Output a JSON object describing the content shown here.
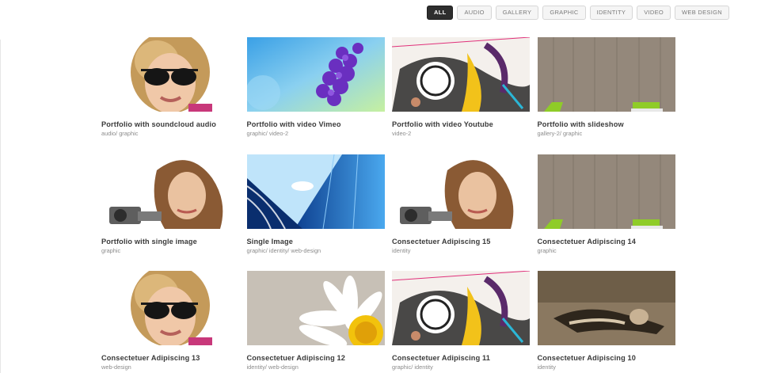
{
  "filters": [
    {
      "label": "ALL",
      "active": true
    },
    {
      "label": "AUDIO",
      "active": false
    },
    {
      "label": "GALLERY",
      "active": false
    },
    {
      "label": "GRAPHIC",
      "active": false
    },
    {
      "label": "IDENTITY",
      "active": false
    },
    {
      "label": "VIDEO",
      "active": false
    },
    {
      "label": "WEB DESIGN",
      "active": false
    }
  ],
  "items": [
    {
      "title": "Portfolio with soundcloud audio",
      "categories": "audio/ graphic",
      "image": "woman-sunglasses-photo"
    },
    {
      "title": "Portfolio with video Vimeo",
      "categories": "graphic/ video-2",
      "image": "purple-flowers-photo"
    },
    {
      "title": "Portfolio with video Youtube",
      "categories": "video-2",
      "image": "abstract-collage-art"
    },
    {
      "title": "Portfolio with slideshow",
      "categories": "gallery-2/ graphic",
      "image": "wood-wall-chairs-photo"
    },
    {
      "title": "Portfolio with single image",
      "categories": "graphic",
      "image": "woman-camera-photo"
    },
    {
      "title": "Single Image",
      "categories": "graphic/ identity/ web-design",
      "image": "glass-building-photo"
    },
    {
      "title": "Consectetuer Adipiscing 15",
      "categories": "identity",
      "image": "woman-camera-photo"
    },
    {
      "title": "Consectetuer Adipiscing 14",
      "categories": "graphic",
      "image": "wood-wall-chairs-photo"
    },
    {
      "title": "Consectetuer Adipiscing 13",
      "categories": "web-design",
      "image": "woman-sunglasses-photo"
    },
    {
      "title": "Consectetuer Adipiscing 12",
      "categories": "identity/ web-design",
      "image": "daisy-photo"
    },
    {
      "title": "Consectetuer Adipiscing 11",
      "categories": "graphic/ identity",
      "image": "abstract-collage-art"
    },
    {
      "title": "Consectetuer Adipiscing 10",
      "categories": "identity",
      "image": "sepia-woman-lying-photo"
    }
  ]
}
